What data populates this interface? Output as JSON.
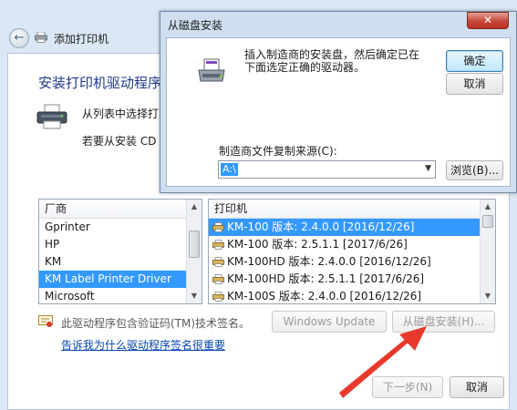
{
  "wizard": {
    "title": "添加打印机",
    "heading": "安装打印机驱动程序",
    "desc1": "从列表中选择打印",
    "desc2": "若要从安装 CD 安",
    "back_icon": "back-arrow-icon"
  },
  "manufacturers": {
    "header": "厂商",
    "items": [
      "Gprinter",
      "HP",
      "KM",
      "KM Label Printer Driver",
      "Microsoft"
    ],
    "selected_index": 3
  },
  "printers": {
    "header": "打印机",
    "items": [
      "KM-100 版本: 2.4.0.0 [2016/12/26]",
      "KM-100 版本: 2.5.1.1 [2017/6/26]",
      "KM-100HD 版本: 2.4.0.0 [2016/12/26]",
      "KM-100HD 版本: 2.5.1.1 [2017/6/26]",
      "KM-100S 版本: 2.4.0.0 [2016/12/26]"
    ],
    "selected_index": 0
  },
  "signature": {
    "text": "此驱动程序包含验证码(TM)技术签名。",
    "link": "告诉我为什么驱动程序签名很重要"
  },
  "buttons": {
    "windows_update": "Windows Update",
    "have_disk": "从磁盘安装(H)...",
    "next": "下一步(N)",
    "cancel": "取消"
  },
  "dialog": {
    "title": "从磁盘安装",
    "close": "✕",
    "message": "插入制造商的安装盘，然后确定已在下面选定正确的驱动器。",
    "ok": "确定",
    "cancel": "取消",
    "copy_label": "制造商文件复制来源(C):",
    "path_value": "A:\\",
    "browse": "浏览(B)..."
  },
  "colors": {
    "selection": "#3399ff",
    "heading": "#1e3a8a",
    "annotation_arrow": "#e8392d"
  }
}
